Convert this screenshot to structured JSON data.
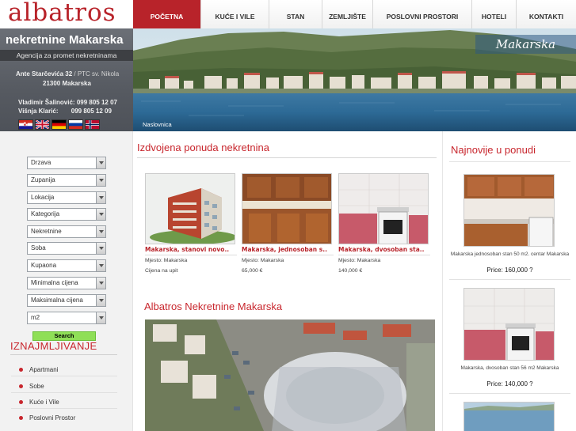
{
  "logo": "albatros",
  "site": {
    "title": "nekretnine Makarska",
    "subtitle": "Agencija za promet nekretninama",
    "address_street": "Ante Starčevića 32",
    "address_extra": "/ PTC sv. Nikola",
    "address_city": "21300 Makarska",
    "contacts": [
      {
        "name": "Vladimir Šalinović:",
        "phone": "099 805 12 07"
      },
      {
        "name": "Višnja Klarić:",
        "phone": "099 805 12 09"
      }
    ],
    "flags": [
      "croatia-flag-icon",
      "uk-flag-icon",
      "germany-flag-icon",
      "russia-flag-icon",
      "norway-flag-icon"
    ]
  },
  "nav": [
    {
      "label": "POČETNA",
      "active": true
    },
    {
      "label": "KUĆE I VILE"
    },
    {
      "label": "STAN"
    },
    {
      "label": "ZEMLJIŠTE"
    },
    {
      "label": "POSLOVNI PROSTORI"
    },
    {
      "label": "HOTELI"
    },
    {
      "label": "KONTAKTI"
    }
  ],
  "banner": {
    "city": "Makarska",
    "breadcrumb": "Naslovnica"
  },
  "search": {
    "selects": [
      "Drzava",
      "Zupanija",
      "Lokacija",
      "Kategorija",
      "Nekretnine",
      "Soba",
      "Kupaona",
      "Minimalna cijena",
      "Maksimalna cijena",
      "m2"
    ],
    "button": "Search"
  },
  "rent": {
    "title": "IZNAJMLJIVANJE",
    "items": [
      "Apartmani",
      "Sobe",
      "Kuće i Vile",
      "Poslovni Prostor"
    ]
  },
  "featured": {
    "title": "Izdvojena ponuda nekretnina",
    "cards": [
      {
        "title": "Makarska, stanovi novo..",
        "location": "Mjesto: Makarska",
        "price": "Cijena na upit"
      },
      {
        "title": "Makarska, jednosoban s..",
        "location": "Mjesto: Makarska",
        "price": "65,000 €"
      },
      {
        "title": "Makarska, dvosoban sta..",
        "location": "Mjesto: Makarska",
        "price": "140,000 €"
      }
    ]
  },
  "about": {
    "title": "Albatros Nekretnine Makarska"
  },
  "newest": {
    "title": "Najnovije u ponudi",
    "items": [
      {
        "caption": "Makarska jednosoban stan 50 m2. centar Makarska",
        "price": "Price: 160,000 ?"
      },
      {
        "caption": "Makarska, dvosoban stan 56 m2 Makarska",
        "price": "Price: 140,000 ?"
      }
    ]
  },
  "colors": {
    "brand_red": "#b8232a",
    "search_green": "#8fdf57",
    "panel_gray": "#5d6168"
  }
}
